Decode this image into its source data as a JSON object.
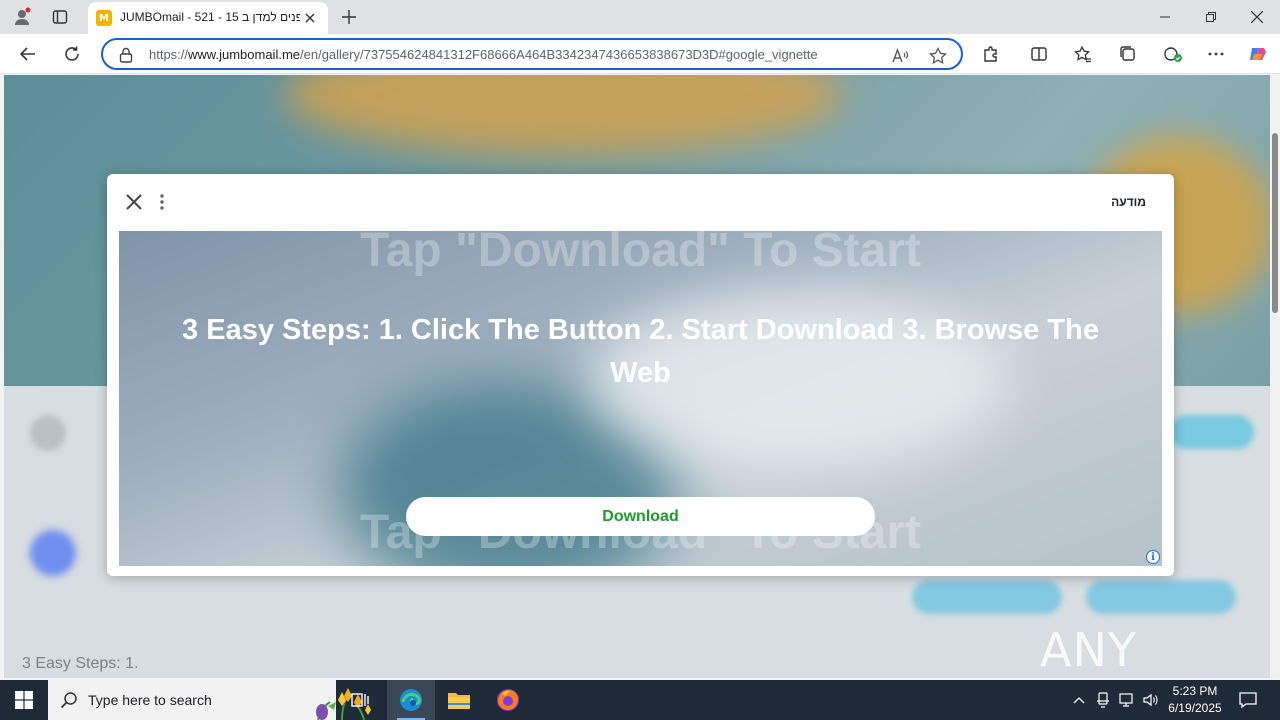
{
  "browser": {
    "tab": {
      "title": "JUMBOmail - 521 - 15 פנים למדן ב",
      "favicon_letter": "M"
    },
    "address": {
      "url_prefix": "https://",
      "url_host": "www.jumbomail.me",
      "url_path": "/en/gallery/737554624841312F68666A464B3342347436653838673D3D#google_vignette"
    }
  },
  "modal": {
    "label": "מודעה",
    "ad": {
      "ghost_text": "Tap \"Download\" To Start",
      "headline": "3 Easy Steps: 1. Click The Button 2. Start Download 3. Browse The Web",
      "button_label": "Download",
      "info_glyph": "i"
    }
  },
  "page": {
    "background_text": "3 Easy Steps: 1.",
    "watermark": "ANY RUN"
  },
  "taskbar": {
    "search_placeholder": "Type here to search",
    "time": "5:23 PM",
    "date": "6/19/2025"
  },
  "colors": {
    "address_border": "#1a5fd6",
    "download_text": "#1e9a2b",
    "taskbar": "#1f2b38"
  }
}
